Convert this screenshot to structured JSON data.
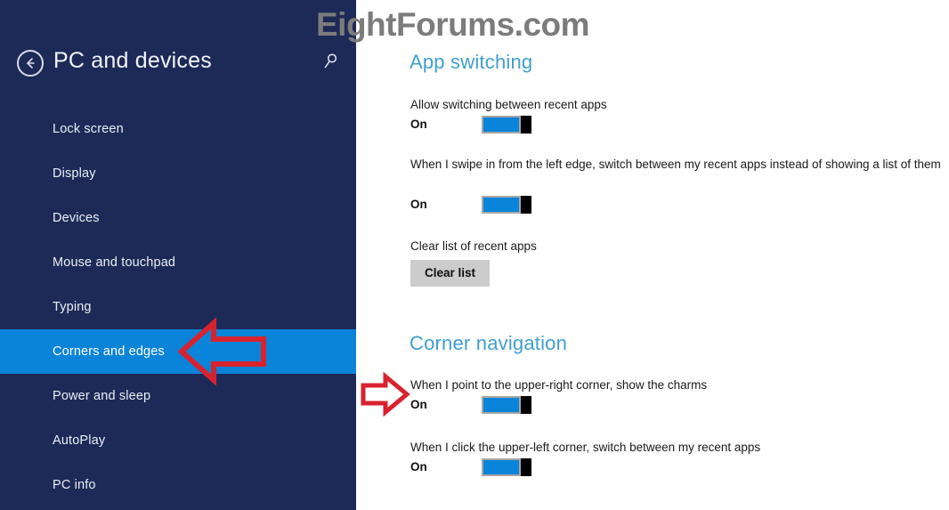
{
  "watermark": {
    "text": "EightForums.com",
    "color": "#7c7c7c"
  },
  "sidebar": {
    "back_icon": "back-arrow-icon",
    "title": "PC and devices",
    "search_icon": "search-icon",
    "accent_color": "#0a84d8",
    "background_color": "#1d2a57",
    "items": [
      {
        "label": "Lock screen",
        "selected": false
      },
      {
        "label": "Display",
        "selected": false
      },
      {
        "label": "Devices",
        "selected": false
      },
      {
        "label": "Mouse and touchpad",
        "selected": false
      },
      {
        "label": "Typing",
        "selected": false
      },
      {
        "label": "Corners and edges",
        "selected": true
      },
      {
        "label": "Power and sleep",
        "selected": false
      },
      {
        "label": "AutoPlay",
        "selected": false
      },
      {
        "label": "PC info",
        "selected": false
      }
    ]
  },
  "content": {
    "heading_color": "#3f9fd0",
    "sections": [
      {
        "heading": "App switching",
        "settings": [
          {
            "label": "Allow switching between recent apps",
            "state_label": "On",
            "toggle_on": true
          },
          {
            "label": "When I swipe in from the left edge, switch between my recent apps instead of showing a list of them",
            "state_label": "On",
            "toggle_on": true
          },
          {
            "label": "Clear list of recent apps",
            "button_label": "Clear list"
          }
        ]
      },
      {
        "heading": "Corner navigation",
        "settings": [
          {
            "label": "When I point to the upper-right corner, show the charms",
            "state_label": "On",
            "toggle_on": true
          },
          {
            "label": "When I click the upper-left corner, switch between my recent apps",
            "state_label": "On",
            "toggle_on": true
          }
        ]
      }
    ]
  },
  "annotations": {
    "color": "#d8232f",
    "arrow_left": {
      "name": "annotation-arrow-left",
      "points_to": "Corners and edges"
    },
    "arrow_right": {
      "name": "annotation-arrow-right",
      "points_to": "When I point to the upper-right corner, show the charms"
    }
  }
}
